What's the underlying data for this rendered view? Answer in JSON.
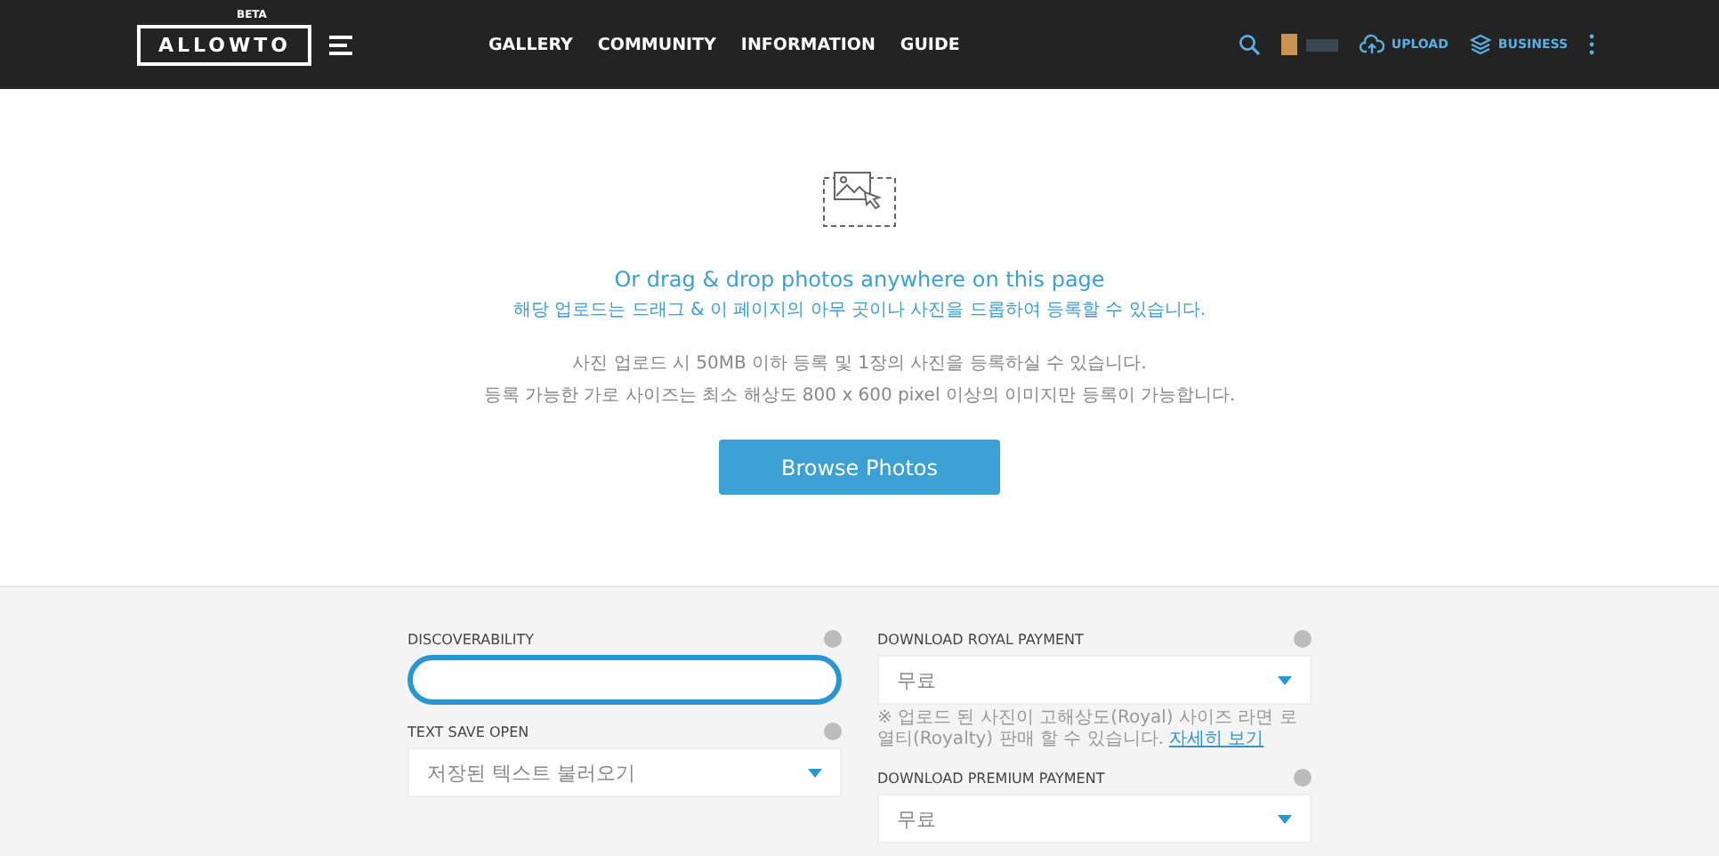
{
  "header": {
    "logo": "ALLOWTO",
    "badge": "BETA",
    "nav": [
      {
        "label": "GALLERY"
      },
      {
        "label": "COMMUNITY"
      },
      {
        "label": "INFORMATION"
      },
      {
        "label": "GUIDE"
      }
    ],
    "actions": [
      {
        "label": "UPLOAD",
        "kind": "upload"
      },
      {
        "label": "BUSINESS",
        "kind": "business"
      }
    ]
  },
  "upload": {
    "title": "Or drag & drop photos anywhere on this page",
    "subtitle": "해당 업로드는 드래그 & 이 페이지의 아무 곳이나 사진을 드롭하여 등록할 수 있습니다.",
    "notes": [
      "사진 업로드 시 50MB 이하 등록 및 1장의 사진을 등록하실 수 있습니다.",
      "등록 가능한 가로 사이즈는 최소 해상도 800 x 600 pixel 이상의 이미지만 등록이 가능합니다."
    ],
    "button": "Browse Photos"
  },
  "form": {
    "left": [
      {
        "label": "DISCOVERABILITY",
        "kind": "input",
        "focused": true
      },
      {
        "label": "TEXT SAVE OPEN",
        "kind": "select",
        "value": "저장된 텍스트 불러오기"
      }
    ],
    "right": [
      {
        "label": "DOWNLOAD ROYAL PAYMENT",
        "kind": "select",
        "value": "무료",
        "note": "※ 업로드 된 사진이 고해상도(Royal) 사이즈 라면 로열티(Royalty) 판매 할 수 있습니다.",
        "link": "자세히 보기"
      },
      {
        "label": "DOWNLOAD PREMIUM PAYMENT",
        "kind": "select",
        "value": "무료"
      }
    ]
  }
}
